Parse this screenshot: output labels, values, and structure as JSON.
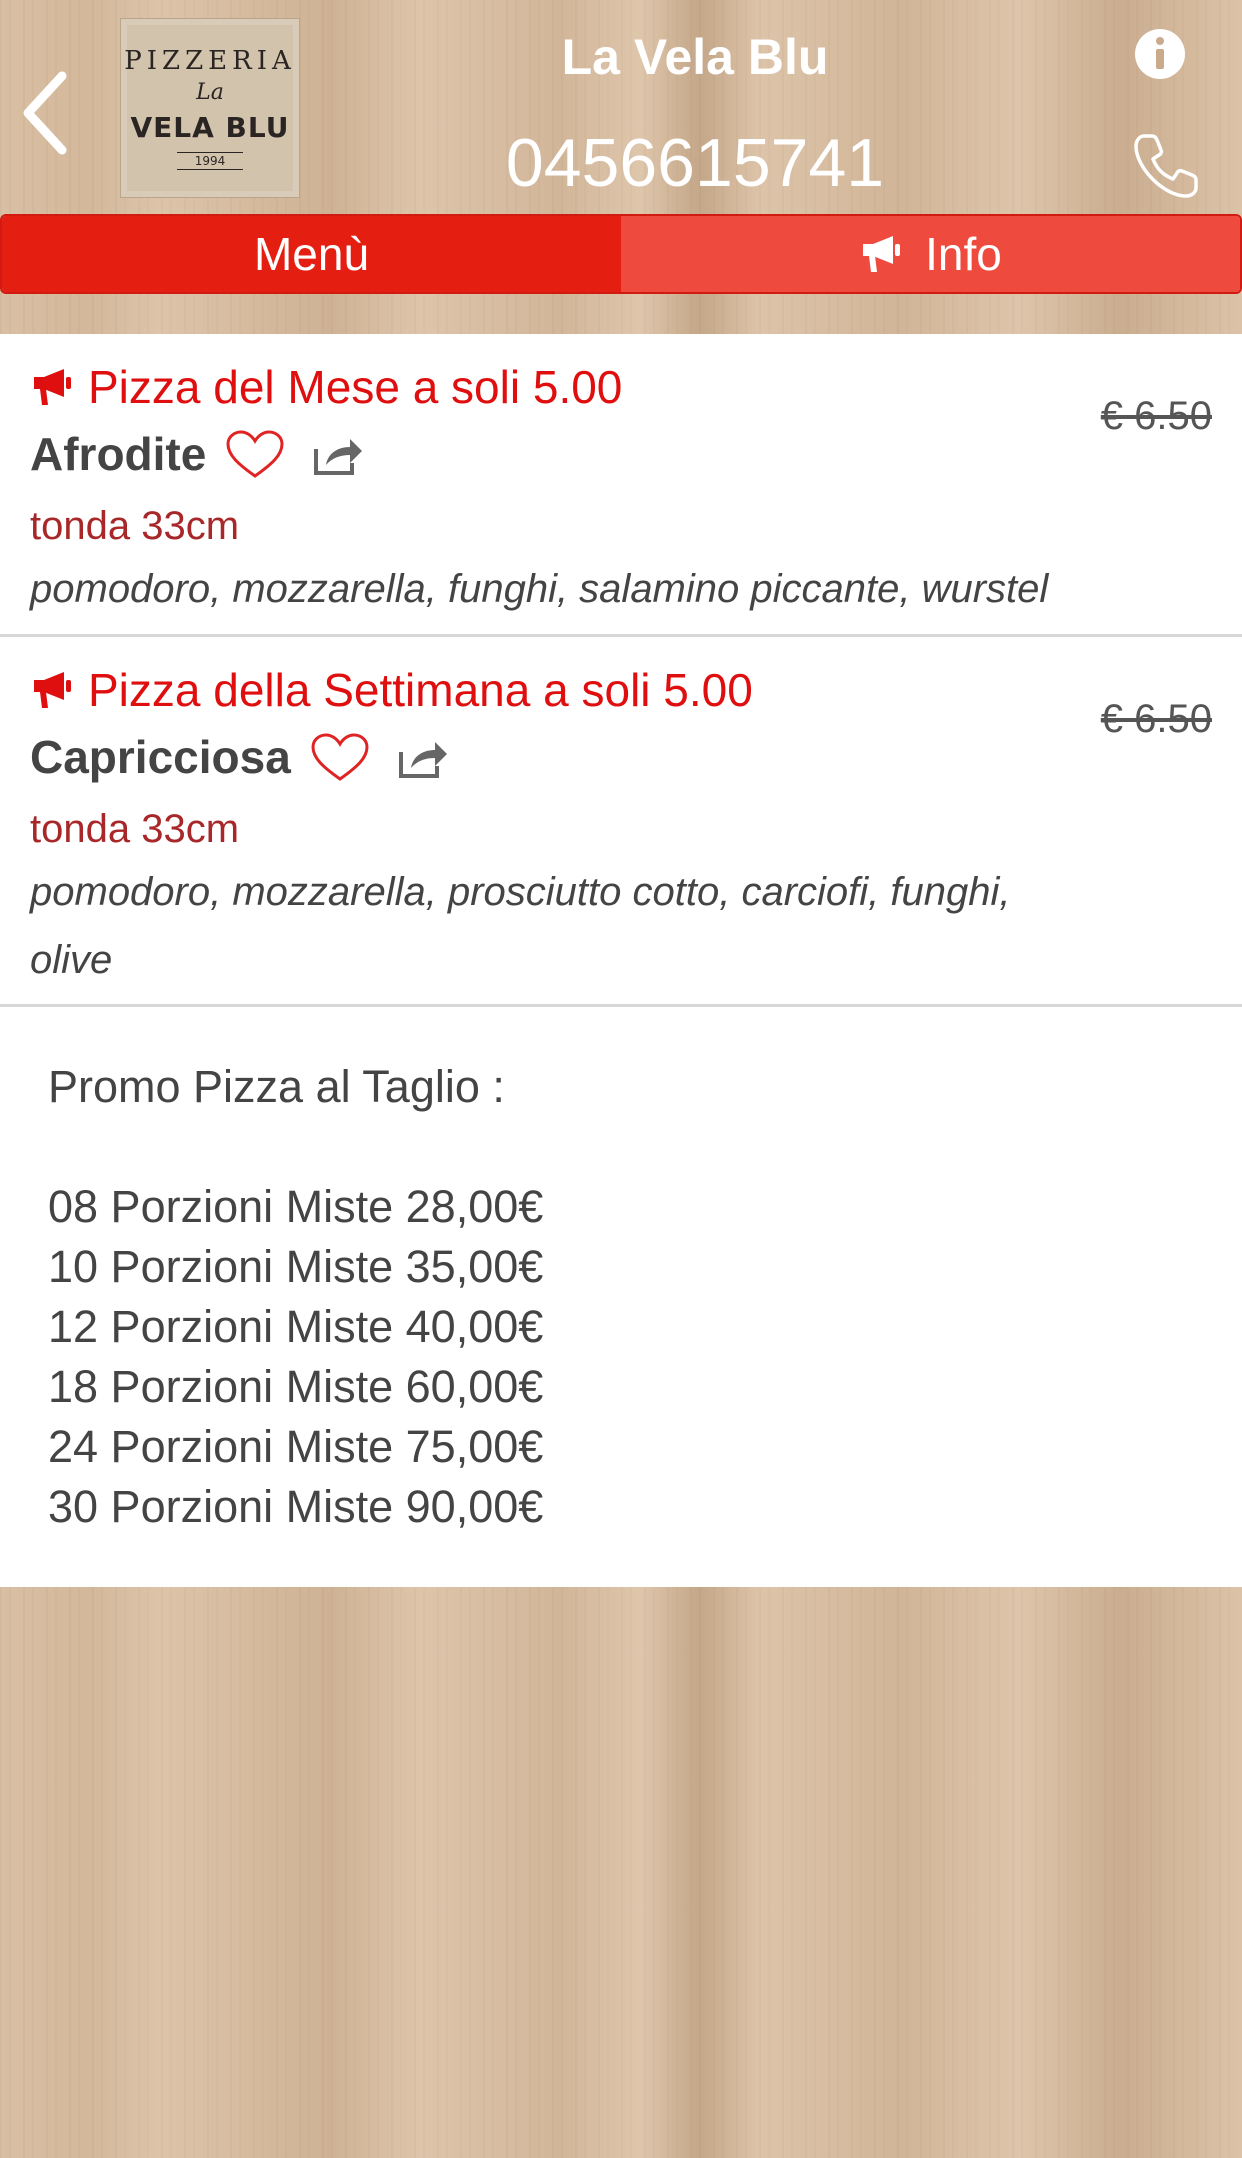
{
  "header": {
    "title": "La Vela Blu",
    "phone": "0456615741",
    "logo": {
      "line1": "PIZZERIA",
      "line2": "La",
      "line3": "VELA BLU",
      "line4": "1994"
    }
  },
  "tabs": [
    {
      "label": "Menù",
      "active": true
    },
    {
      "label": "Info",
      "active": false,
      "icon": "megaphone-icon"
    }
  ],
  "items": [
    {
      "promo": "Pizza del Mese a soli 5.00",
      "name": "Afrodite",
      "size": "tonda 33cm",
      "ingredients": "pomodoro, mozzarella, funghi, salamino piccante, wurstel",
      "old_price": "€ 6.50"
    },
    {
      "promo": "Pizza della Settimana a soli 5.00",
      "name": "Capricciosa",
      "size": "tonda 33cm",
      "ingredients_line1": "pomodoro, mozzarella, prosciutto cotto, carciofi, funghi,",
      "ingredients_line2": "olive",
      "old_price": "€ 6.50"
    }
  ],
  "promo_taglio": {
    "title": "Promo Pizza al Taglio :",
    "lines": [
      "08 Porzioni Miste 28,00€",
      "10 Porzioni Miste 35,00€",
      "12 Porzioni Miste 40,00€",
      "18 Porzioni Miste 60,00€",
      "24 Porzioni Miste 75,00€",
      "30 Porzioni Miste 90,00€"
    ]
  },
  "colors": {
    "accent_red": "#e41f12",
    "tab_inactive": "#ef4a3e",
    "size_red": "#a8282a",
    "text_dark": "#444444"
  }
}
